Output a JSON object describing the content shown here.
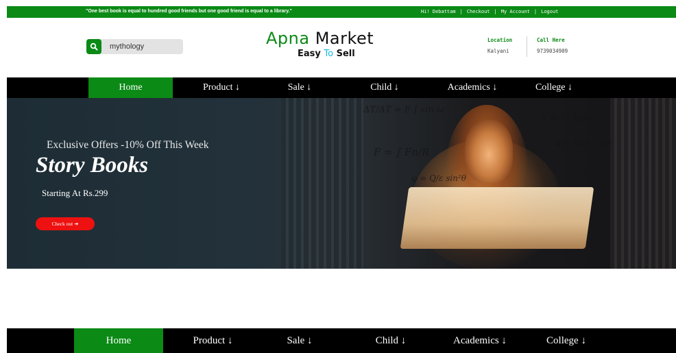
{
  "topbar": {
    "quote": "\"One best book is equal to hundred good friends but one good friend is equal to a library.\"",
    "greeting": "Hi! Debattam",
    "links": [
      "Checkout",
      "My Account",
      "Logout"
    ]
  },
  "search": {
    "value": "mythology",
    "icon": "search-icon"
  },
  "brand": {
    "name_part1": "Apna ",
    "name_part2": "Market",
    "tag_part1": "Easy ",
    "tag_to": "To",
    "tag_part2": " Sell"
  },
  "location": {
    "label": "Location",
    "value": "Kalyani"
  },
  "call": {
    "label": "Call Here",
    "value": "9739034909"
  },
  "nav": {
    "items": [
      {
        "label": "Home"
      },
      {
        "label": "Product ↓"
      },
      {
        "label": "Sale ↓"
      },
      {
        "label": "Child ↓"
      },
      {
        "label": "Academics ↓"
      },
      {
        "label": "College ↓"
      }
    ]
  },
  "hero": {
    "offer": "Exclusive Offers -10% Off This Week",
    "title": "Story Books",
    "price": "Starting At Rs.299",
    "cta": "Check out ➔"
  },
  "colors": {
    "brand_green": "#0b8a16",
    "cta_red": "#ee1111",
    "nav_bg": "#000000"
  }
}
